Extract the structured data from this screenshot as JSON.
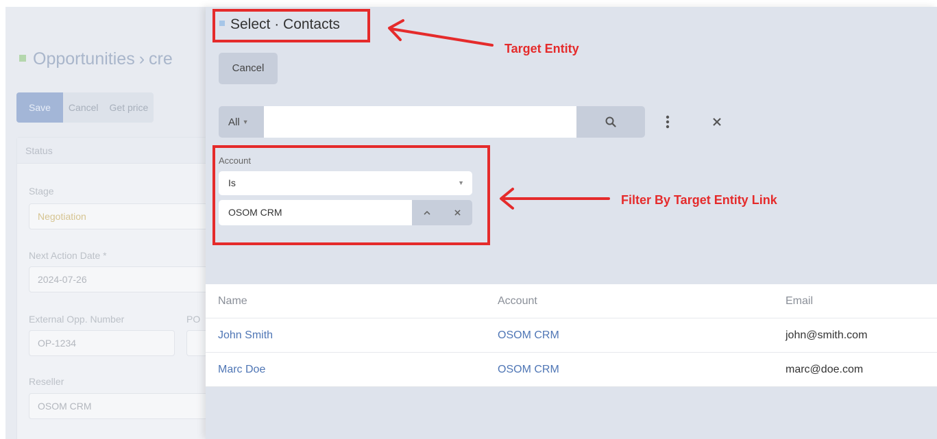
{
  "background": {
    "title_prefix": "Opportunities",
    "title_sep": "›",
    "title_suffix": "cre",
    "toolbar": {
      "save": "Save",
      "cancel": "Cancel",
      "get_price": "Get price"
    },
    "status_panel": {
      "heading": "Status",
      "stage_label": "Stage",
      "stage_value": "Negotiation",
      "next_action_label": "Next Action Date *",
      "next_action_value": "2024-07-26",
      "external_label": "External Opp. Number",
      "po_label": "PO",
      "external_value": "OP-1234",
      "reseller_label": "Reseller",
      "reseller_value": "OSOM CRM"
    }
  },
  "modal": {
    "title": "Select · Contacts",
    "cancel_label": "Cancel",
    "search": {
      "scope_label": "All",
      "query": "",
      "placeholder": ""
    },
    "filter": {
      "field_label": "Account",
      "operator": "Is",
      "value": "OSOM CRM"
    },
    "table": {
      "columns": [
        "Name",
        "Account",
        "Email"
      ],
      "rows": [
        {
          "name": "John Smith",
          "account": "OSOM CRM",
          "email": "john@smith.com"
        },
        {
          "name": "Marc Doe",
          "account": "OSOM CRM",
          "email": "marc@doe.com"
        }
      ]
    }
  },
  "annotations": {
    "target_entity": "Target Entity",
    "filter_by_link": "Filter By Target Entity Link",
    "color": "#e52b2b"
  },
  "icons": {
    "search": "search-icon",
    "more": "vertical-dots-icon",
    "clear": "close-icon",
    "caret": "caret-down-icon",
    "chevron": "chevron-up-icon"
  }
}
